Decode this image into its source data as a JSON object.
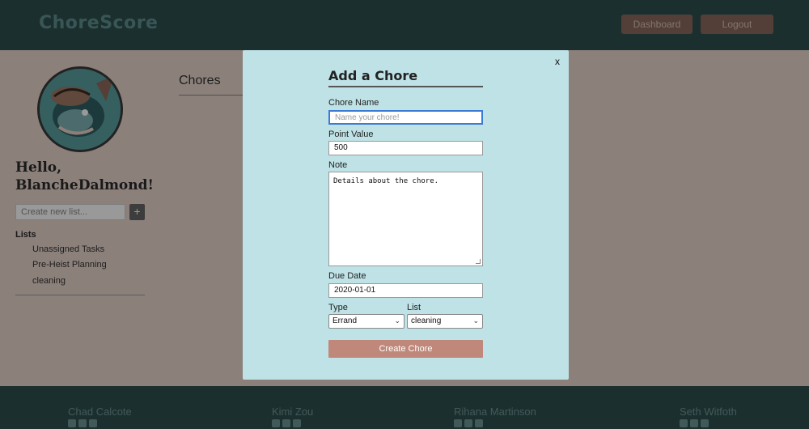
{
  "header": {
    "logo": "ChoreScore",
    "dashboard_label": "Dashboard",
    "logout_label": "Logout"
  },
  "sidebar": {
    "greeting": "Hello, BlancheDalmond!",
    "new_list_placeholder": "Create new list...",
    "add_label": "+",
    "lists_heading": "Lists",
    "lists": [
      "Unassigned Tasks",
      "Pre-Heist Planning",
      "cleaning"
    ]
  },
  "main": {
    "title": "Chores"
  },
  "footer": {
    "contributors": [
      "Chad Calcote",
      "Kimi Zou",
      "Rihana Martinson",
      "Seth Witfoth"
    ]
  },
  "modal": {
    "close_label": "x",
    "title": "Add a Chore",
    "chore_name_label": "Chore Name",
    "chore_name_placeholder": "Name your chore!",
    "point_value_label": "Point Value",
    "point_value": "500",
    "note_label": "Note",
    "note_value": "Details about the chore.",
    "due_date_label": "Due Date",
    "due_date": "2020-01-01",
    "type_label": "Type",
    "type_value": "Errand",
    "list_label": "List",
    "list_value": "cleaning",
    "submit_label": "Create Chore"
  }
}
